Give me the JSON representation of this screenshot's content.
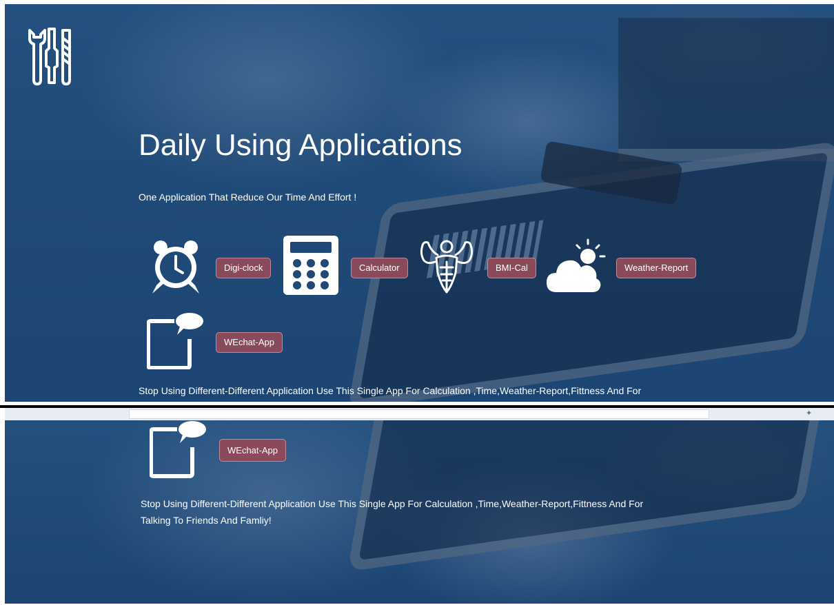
{
  "header": {
    "logo_icon": "tools-icon",
    "title": "Daily Using Applications",
    "subtitle": "One Application That Reduce Our Time And Effort !"
  },
  "apps": [
    {
      "label": "Digi-clock",
      "icon": "alarm-clock-icon"
    },
    {
      "label": "Calculator",
      "icon": "calculator-icon"
    },
    {
      "label": "BMI-Cal",
      "icon": "bodybuilder-icon"
    },
    {
      "label": "Weather-Report",
      "icon": "cloud-sun-icon"
    },
    {
      "label": "WEchat-App",
      "icon": "chat-tablet-icon"
    }
  ],
  "description": {
    "line1": "Stop Using Different-Different Application Use This Single App For Calculation ,Time,Weather-Report,Fittness And For",
    "line2": "Talking To Friends And Famliy!"
  },
  "colors": {
    "background": "#1f4a78",
    "button": "#8b4a5c",
    "text": "#ffffff"
  }
}
